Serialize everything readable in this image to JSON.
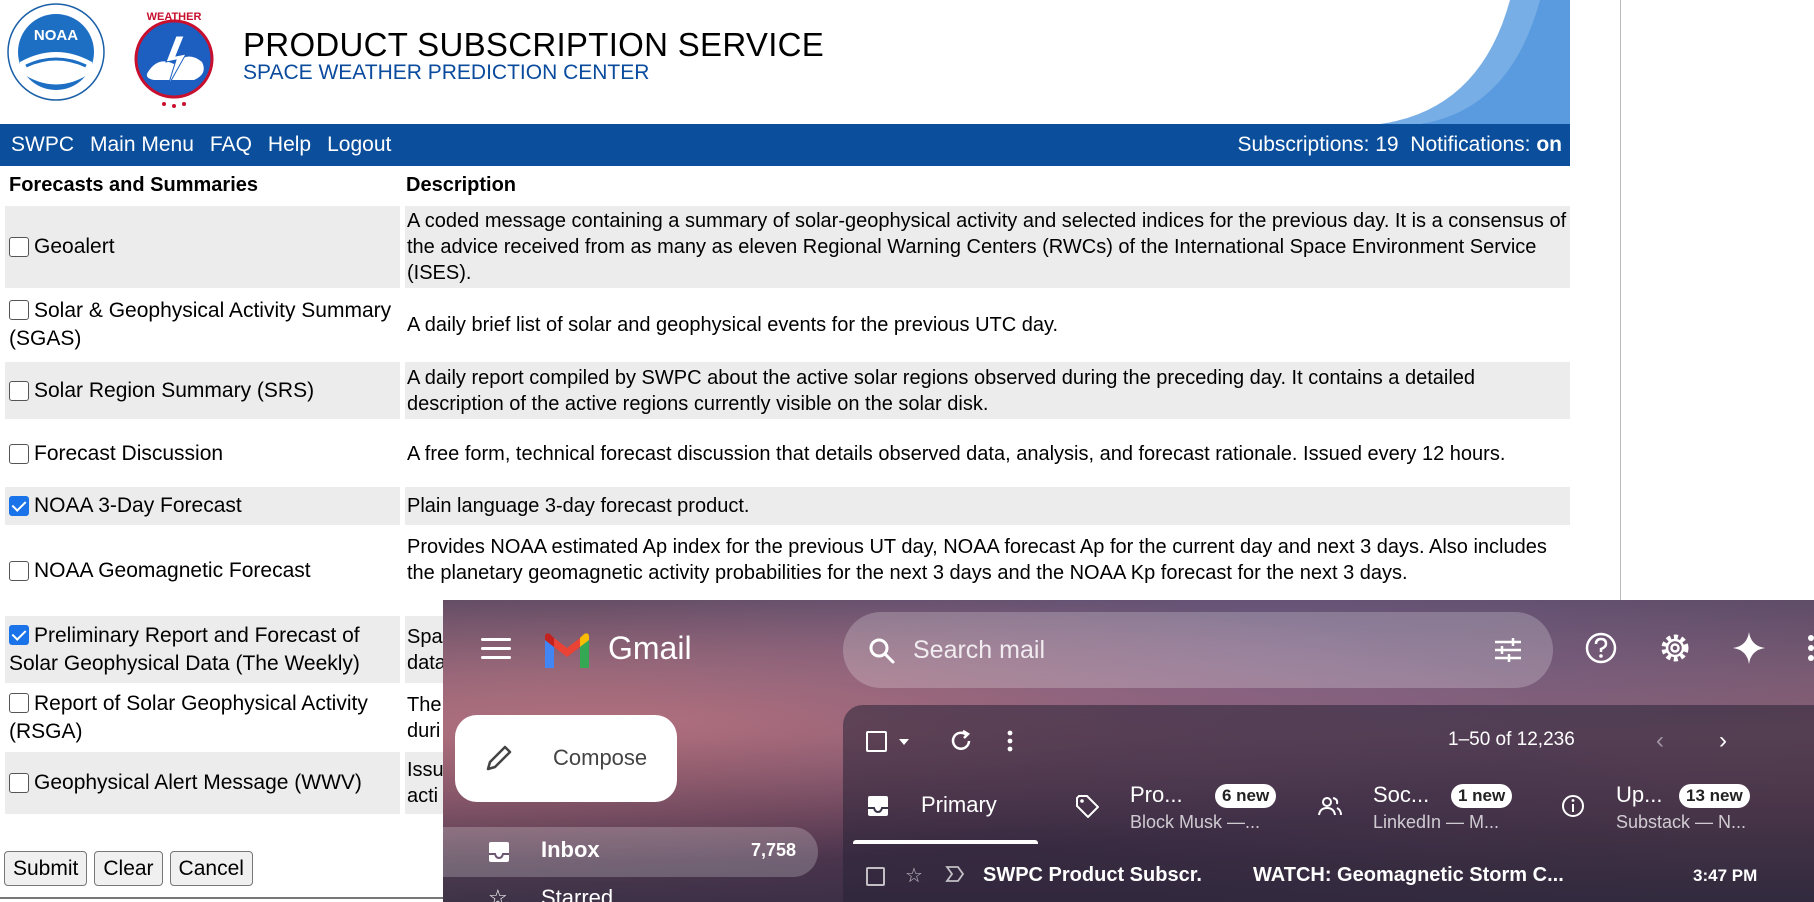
{
  "header": {
    "title": "PRODUCT SUBSCRIPTION SERVICE",
    "subtitle": "SPACE WEATHER PREDICTION CENTER",
    "noaa_logo_text": "NOAA",
    "nws_logo_text": "NATIONAL WEATHER SERVICE"
  },
  "nav": {
    "links": [
      "SWPC",
      "Main Menu",
      "FAQ",
      "Help",
      "Logout"
    ],
    "subscriptions_label": "Subscriptions: 19",
    "notifications_label": "Notifications:",
    "notifications_value": "on"
  },
  "table": {
    "col_product": "Forecasts and Summaries",
    "col_description": "Description",
    "rows": [
      {
        "name": "Geoalert",
        "checked": false,
        "description": "A coded message containing a summary of solar-geophysical activity and selected indices for the previous day. It is a consensus of the advice received from as many as eleven Regional Warning Centers (RWCs) of the International Space Environment Service (ISES)."
      },
      {
        "name": "Solar & Geophysical Activity Summary (SGAS)",
        "checked": false,
        "description": "A daily brief list of solar and geophysical events for the previous UTC day."
      },
      {
        "name": "Solar Region Summary (SRS)",
        "checked": false,
        "description": "A daily report compiled by SWPC about the active solar regions observed during the preceding day. It contains a detailed description of the active regions currently visible on the solar disk."
      },
      {
        "name": "Forecast Discussion",
        "checked": false,
        "description": "A free form, technical forecast discussion that details observed data, analysis, and forecast rationale. Issued every 12 hours."
      },
      {
        "name": "NOAA 3-Day Forecast",
        "checked": true,
        "description": "Plain language 3-day forecast product."
      },
      {
        "name": "NOAA Geomagnetic Forecast",
        "checked": false,
        "description": "Provides NOAA estimated Ap index for the previous UT day, NOAA forecast Ap for the current day and next 3 days. Also includes the planetary geomagnetic activity probabilities for the next 3 days and the NOAA Kp forecast for the next 3 days."
      },
      {
        "name": "Preliminary Report and Forecast of Solar Geophysical Data (The Weekly)",
        "checked": true,
        "description": "Spa data"
      },
      {
        "name": "Report of Solar Geophysical Activity (RSGA)",
        "checked": false,
        "description": "The duri"
      },
      {
        "name": "Geophysical Alert Message (WWV)",
        "checked": false,
        "description": "Issu acti"
      }
    ]
  },
  "buttons": {
    "submit": "Submit",
    "clear": "Clear",
    "cancel": "Cancel"
  },
  "gmail": {
    "brand": "Gmail",
    "search_placeholder": "Search mail",
    "compose_label": "Compose",
    "inbox_label": "Inbox",
    "inbox_count": "7,758",
    "starred_label": "Starred",
    "range_text": "1–50 of 12,236",
    "tabs": [
      {
        "name": "Primary",
        "badge": "",
        "snippet": ""
      },
      {
        "name": "Pro...",
        "badge": "6 new",
        "snippet": "Block Musk —..."
      },
      {
        "name": "Soc...",
        "badge": "1 new",
        "snippet": "LinkedIn — M..."
      },
      {
        "name": "Up...",
        "badge": "13 new",
        "snippet": "Substack — N..."
      }
    ],
    "email": {
      "sender": "SWPC Product Subscr.",
      "subject": "WATCH: Geomagnetic Storm C...",
      "time": "3:47 PM"
    },
    "icons": [
      "menu-icon",
      "search-icon",
      "tune-icon",
      "help-icon",
      "gear-icon",
      "sparkle-icon",
      "apps-icon",
      "pencil-icon",
      "inbox-icon",
      "star-icon",
      "refresh-icon",
      "more-vert-icon",
      "tag-icon",
      "people-icon",
      "info-icon"
    ]
  }
}
